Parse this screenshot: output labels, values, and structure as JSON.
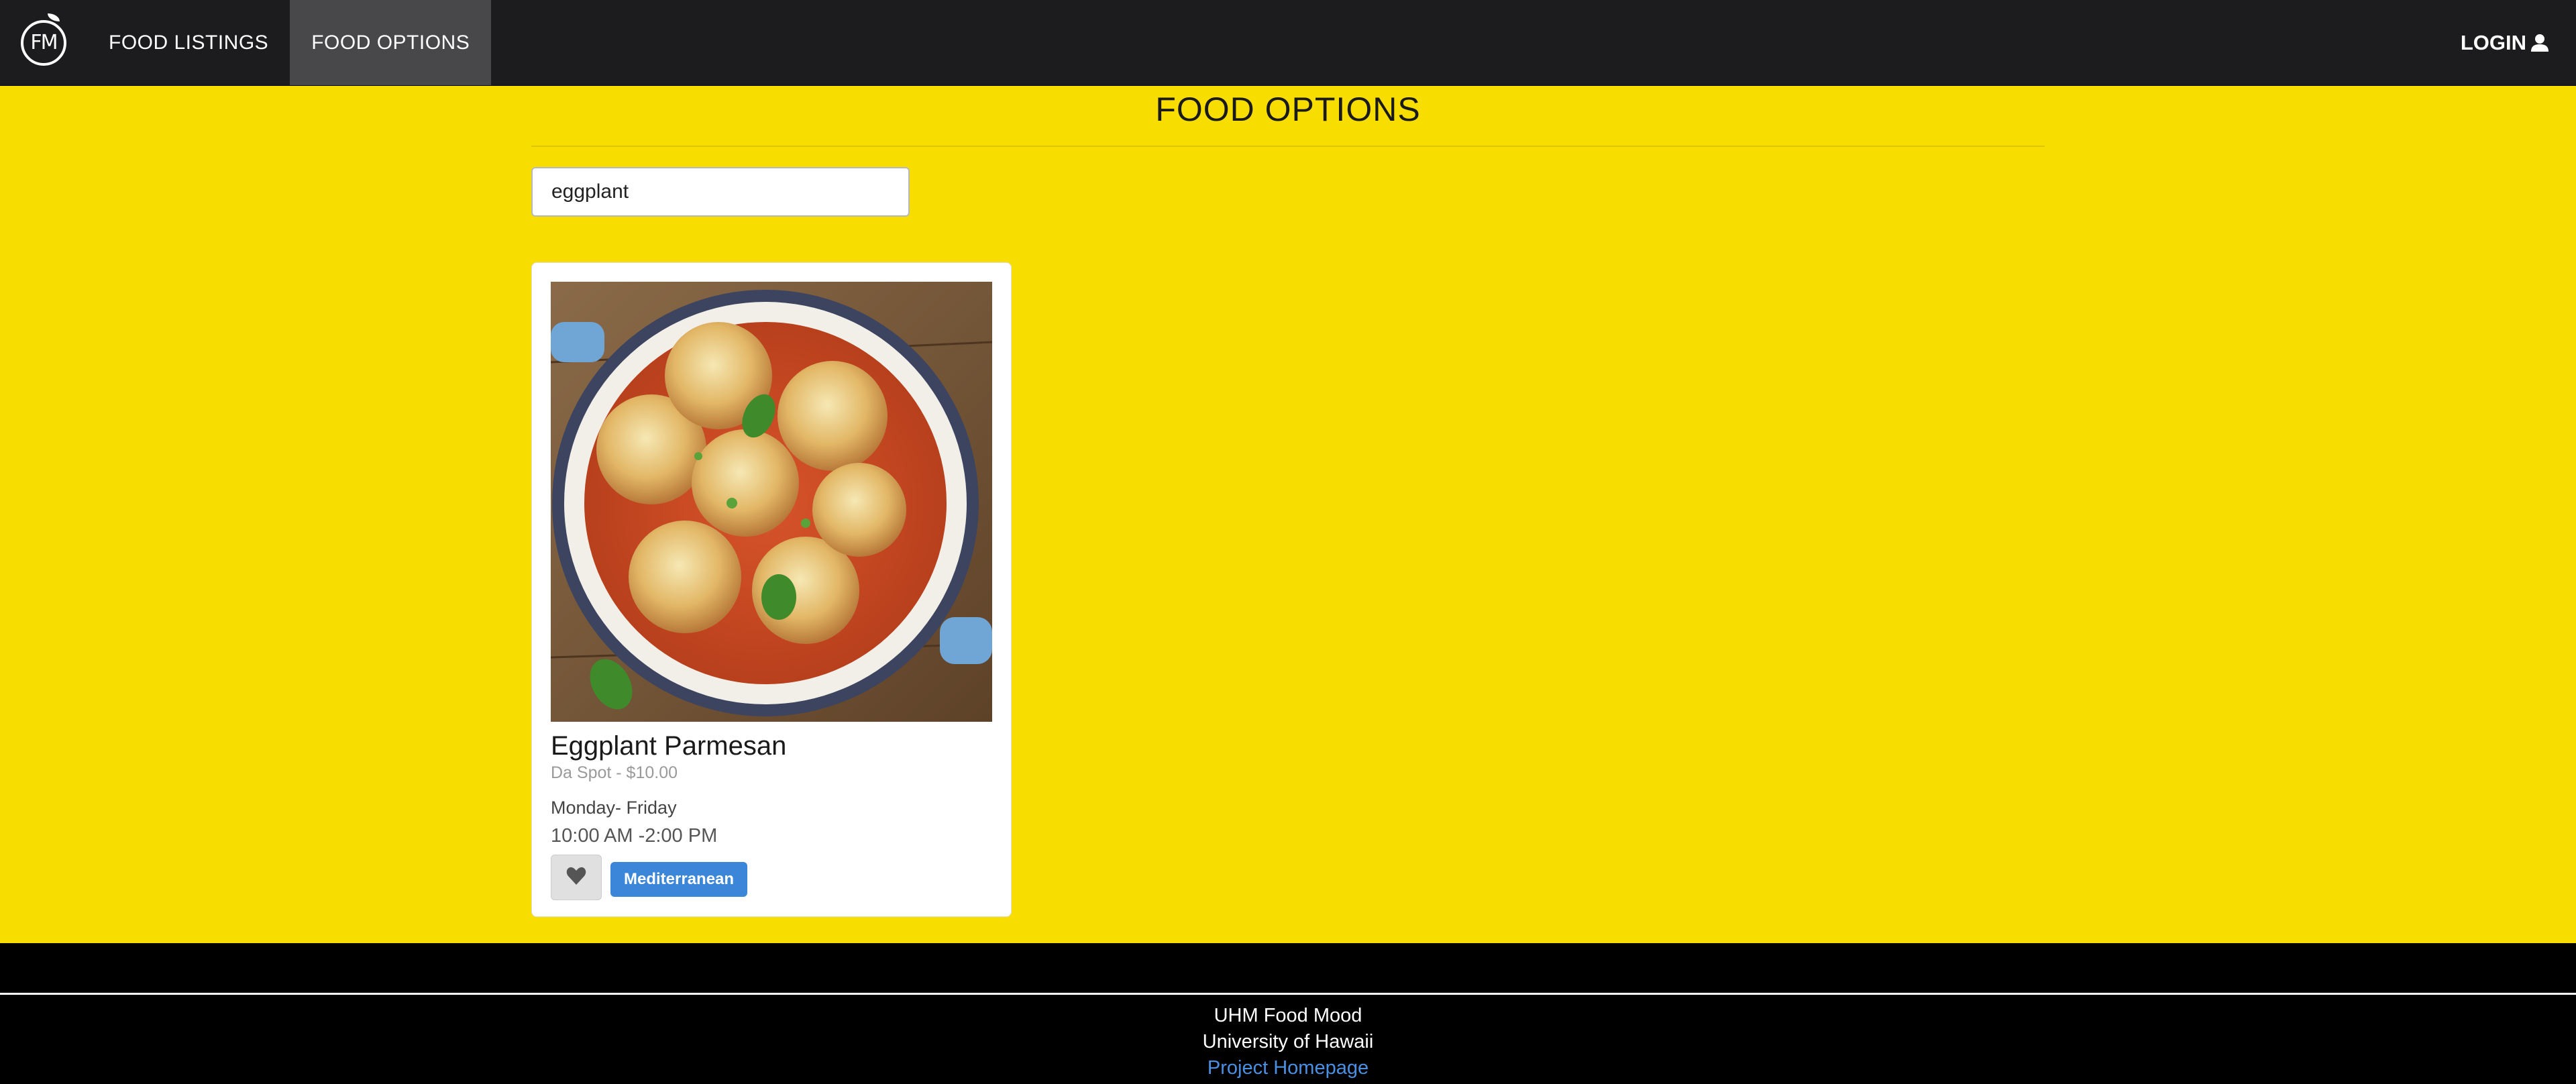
{
  "nav": {
    "logo_text": "FM",
    "items": [
      {
        "label": "FOOD LISTINGS",
        "active": false
      },
      {
        "label": "FOOD OPTIONS",
        "active": true
      }
    ],
    "login_label": "LOGIN"
  },
  "page": {
    "title": "FOOD OPTIONS"
  },
  "search": {
    "value": "eggplant"
  },
  "card": {
    "name": "Eggplant Parmesan",
    "meta": "Da Spot - $10.00",
    "days": "Monday- Friday",
    "hours": "10:00 AM -2:00 PM",
    "tag": "Mediterranean",
    "favorite_icon": "heart-icon"
  },
  "footer": {
    "line1": "UHM Food Mood",
    "line2": "University of Hawaii",
    "link": "Project Homepage"
  },
  "colors": {
    "background": "#f8dd00",
    "navbar": "#1c1c1e",
    "nav_active": "#48484a",
    "tag": "#3b86d8",
    "link": "#4a90e2"
  }
}
